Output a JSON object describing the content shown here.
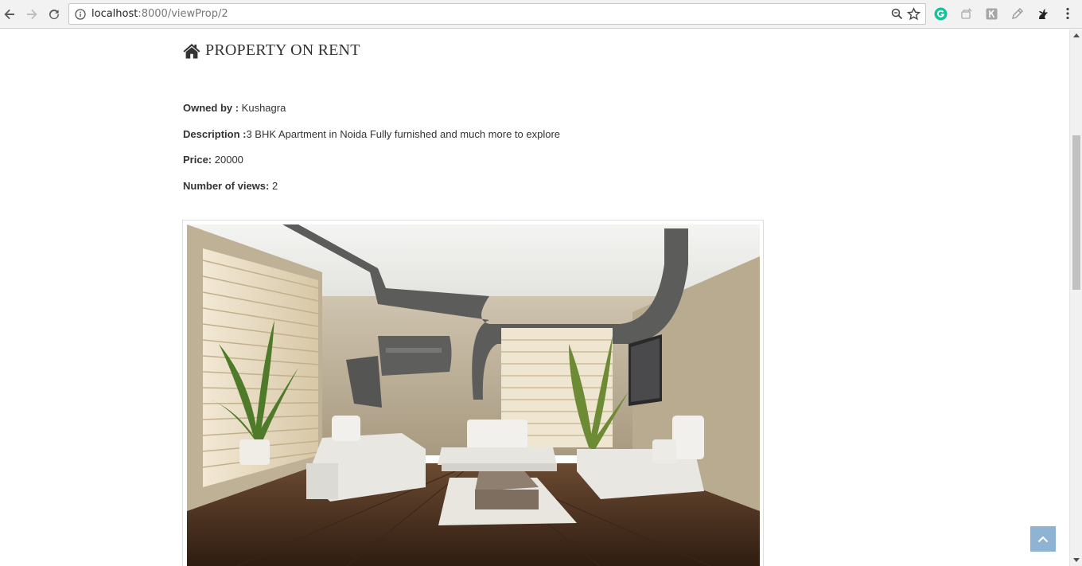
{
  "browser": {
    "url_host": "localhost",
    "url_rest": ":8000/viewProp/2",
    "icons": [
      "back-icon",
      "forward-icon",
      "reload-icon",
      "info-icon",
      "zoom-icon",
      "star-icon",
      "grammarly-icon",
      "extension-icon",
      "extension-icon",
      "pen-icon",
      "extension-icon",
      "menu-icon"
    ]
  },
  "property": {
    "heading": "PROPERTY ON RENT",
    "owner_label": "Owned by :",
    "owner_value": " Kushagra",
    "description_label": "Description :",
    "description_value": "3 BHK Apartment in Noida Fully furnished and much more to explore",
    "price_label": "Price:",
    "price_value": " 20000",
    "views_label": "Number of views:",
    "views_value": " 2"
  },
  "colors": {
    "back_to_top": "#8fb4d3",
    "grammarly": "#15c39a"
  }
}
